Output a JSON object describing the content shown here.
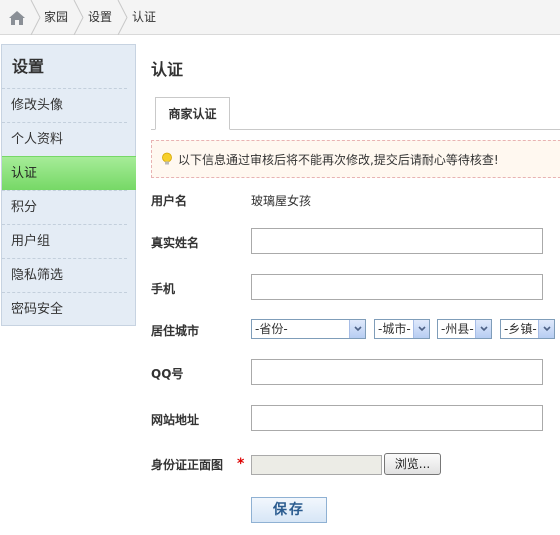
{
  "breadcrumb": {
    "home_icon": "home-icon",
    "items": [
      "家园",
      "设置",
      "认证"
    ]
  },
  "sidebar": {
    "title": "设置",
    "items": [
      {
        "label": "修改头像",
        "active": false
      },
      {
        "label": "个人资料",
        "active": false
      },
      {
        "label": "认证",
        "active": true
      },
      {
        "label": "积分",
        "active": false
      },
      {
        "label": "用户组",
        "active": false
      },
      {
        "label": "隐私筛选",
        "active": false
      },
      {
        "label": "密码安全",
        "active": false
      }
    ],
    "active_color": "#8ae27a"
  },
  "main": {
    "title": "认证",
    "tab": "商家认证",
    "notice": {
      "icon": "lightbulb-icon",
      "text": "以下信息通过审核后将不能再次修改,提交后请耐心等待核查!"
    },
    "form": {
      "username_label": "用户名",
      "username_value": "玻璃屋女孩",
      "realname_label": "真实姓名",
      "realname_value": "",
      "phone_label": "手机",
      "phone_value": "",
      "city_label": "居住城市",
      "province": "-省份-",
      "city": "-城市-",
      "county": "-州县-",
      "town": "-乡镇-",
      "qq_label": "QQ号",
      "qq_value": "",
      "website_label": "网站地址",
      "website_value": "",
      "idcard_label": "身份证正面图",
      "required_mark": "*",
      "browse_label": "浏览...",
      "save_label": "保存"
    }
  }
}
